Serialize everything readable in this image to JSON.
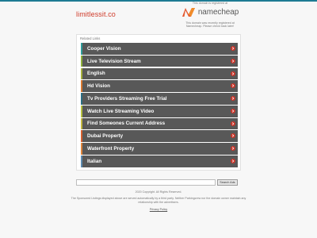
{
  "site": {
    "name": "limitlessit.co"
  },
  "registrar": {
    "line1": "This domain is registered at",
    "logo_text": "namecheap",
    "note_line1": "This domain was recently registered at",
    "note_line2": "Namecheap. Please check back later!"
  },
  "related": {
    "label": "Related Links",
    "links": [
      {
        "label": "Cooper Vision",
        "accent": "#2f9e9b"
      },
      {
        "label": "Live Television Stream",
        "accent": "#8fb23a"
      },
      {
        "label": "English",
        "accent": "#a8b13c"
      },
      {
        "label": "Hd Vision",
        "accent": "#d9782f"
      },
      {
        "label": "Tv Providers Streaming Free Trial",
        "accent": "#2b6f83"
      },
      {
        "label": "Watch Live Streaming Video",
        "accent": "#b7c23e"
      },
      {
        "label": "Find Someones Current Address",
        "accent": "#c4b83f"
      },
      {
        "label": "Dubai Property",
        "accent": "#d8602e"
      },
      {
        "label": "Waterfront Property",
        "accent": "#e0853a"
      },
      {
        "label": "Italian",
        "accent": "#5d8bb0"
      }
    ]
  },
  "search": {
    "value": "",
    "button_label": "Search Ads"
  },
  "footer": {
    "copyright": "2020 Copyright. All Rights Reserved.",
    "disclaimer_line1": "The Sponsored Listings displayed above are served automatically by a third party. Neither Parkingcrew nor the domain owner maintain any",
    "disclaimer_line2": "relationship with the advertisers.",
    "privacy_label": "Privacy Policy"
  },
  "colors": {
    "brand": "#cf3b2a",
    "accent": "#1e7b93",
    "row": "#585858",
    "arrow": "#c8352a"
  }
}
